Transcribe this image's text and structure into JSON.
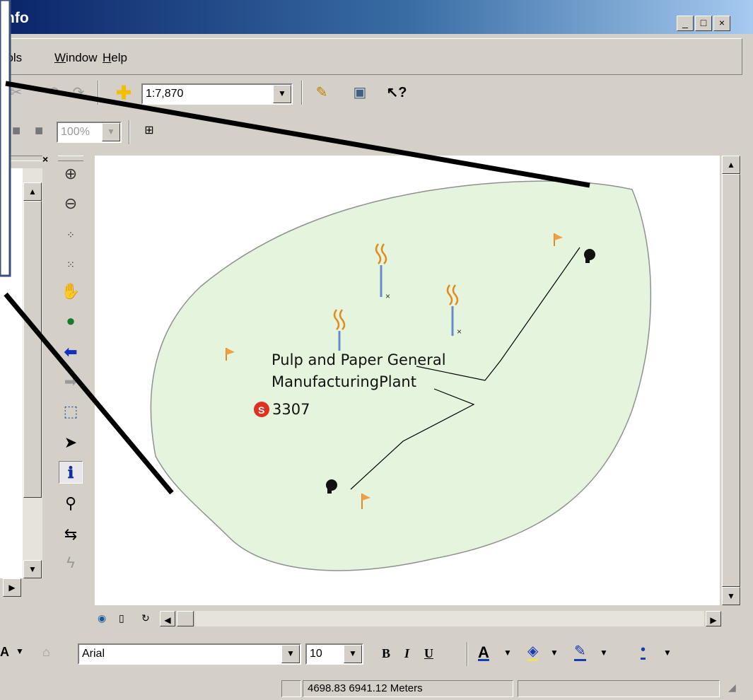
{
  "window": {
    "title": "nfo",
    "minimize": "_",
    "maximize": "□",
    "close": "×"
  },
  "menu": {
    "tools": "ools",
    "window": "Window",
    "help": "Help"
  },
  "toolbar": {
    "scale_value": "1:7,870",
    "zoom_value": "100%"
  },
  "map": {
    "label_line1": "Pulp and Paper General",
    "label_line2": "ManufacturingPlant",
    "label_id": "3307",
    "fill_color": "#e5f5dd",
    "outline_color": "#909090"
  },
  "font_toolbar": {
    "font_name": "Arial",
    "font_size": "10",
    "bold": "B",
    "italic": "I",
    "underline": "U",
    "font_color_letter": "A"
  },
  "status": {
    "coordinates": "4698.83  6941.12 Meters"
  }
}
